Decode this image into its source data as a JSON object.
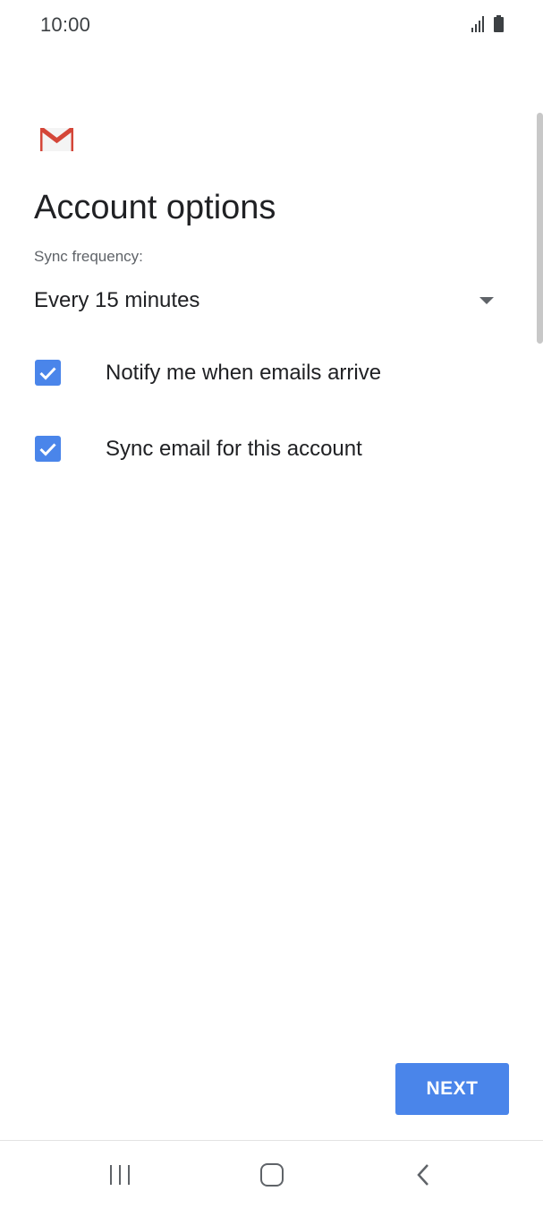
{
  "status_bar": {
    "time": "10:00",
    "signal_icon": "signal-bars-icon",
    "battery_icon": "battery-icon"
  },
  "app": {
    "logo_icon": "gmail-logo-icon",
    "brand_color": "#d44638"
  },
  "page": {
    "title": "Account options",
    "sync_frequency_label": "Sync frequency:",
    "sync_frequency_value": "Every 15 minutes",
    "options": [
      {
        "label": "Notify me when emails arrive",
        "checked": true
      },
      {
        "label": "Sync email for this account",
        "checked": true
      }
    ],
    "next_label": "NEXT"
  },
  "colors": {
    "accent": "#4a85ea",
    "text_primary": "#202124",
    "text_secondary": "#5f6368"
  },
  "nav_bar": {
    "icons": [
      "recents-icon",
      "home-icon",
      "back-icon"
    ]
  }
}
